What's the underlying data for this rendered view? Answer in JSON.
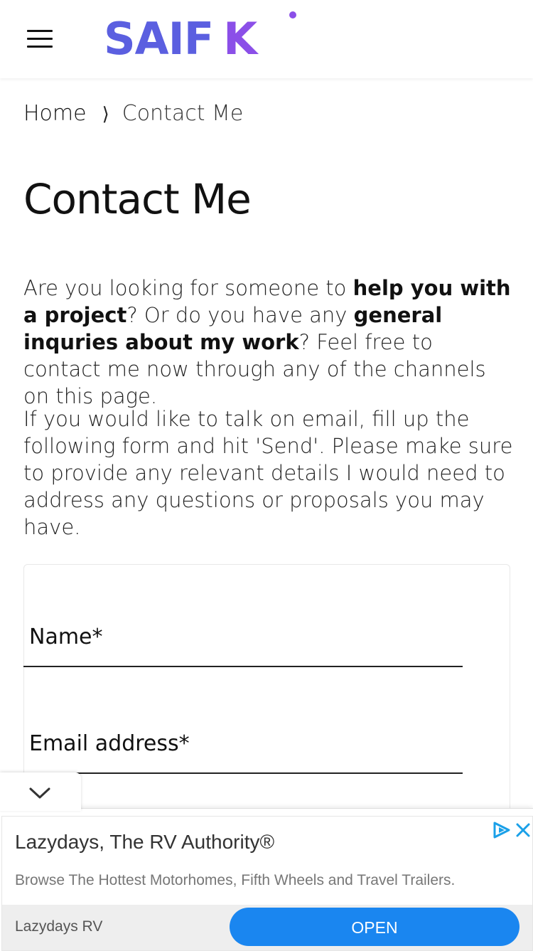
{
  "header": {
    "menu_icon": "hamburger-menu-icon",
    "logo_part1": "SAIF",
    "logo_part2": "K"
  },
  "breadcrumb": {
    "home": "Home",
    "separator": "⟩",
    "current": "Contact Me"
  },
  "page": {
    "title": "Contact Me",
    "intro1_parts": {
      "a": "Are you looking for someone to ",
      "b": "help you with a project",
      "c": "? Or do you have any ",
      "d": "general inquries about my work",
      "e": "? Feel free to contact me now through any of the channels on this page."
    },
    "intro2": "If you would like to talk on email, fill up the following form and hit 'Send'. Please make sure to provide any relevant details I would need to address any questions or proposals you may have."
  },
  "form": {
    "name_label": "Name*",
    "email_label": "Email address*"
  },
  "ad": {
    "title": "Lazydays, The RV Authority®",
    "description": "Browse The Hottest Motorhomes, Fifth Wheels and Travel Trailers.",
    "brand": "Lazydays RV",
    "cta": "OPEN",
    "accent_color": "#1a86f0"
  },
  "colors": {
    "logo_primary": "#5b5fe0",
    "logo_accent": "#8b4fe8"
  }
}
